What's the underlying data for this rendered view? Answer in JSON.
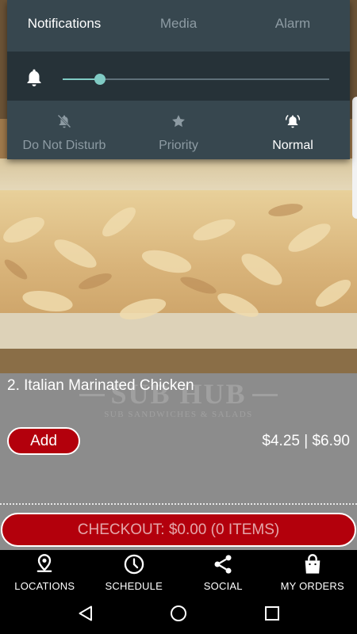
{
  "volume_panel": {
    "tabs": [
      {
        "label": "Notifications",
        "active": true
      },
      {
        "label": "Media",
        "active": false
      },
      {
        "label": "Alarm",
        "active": false
      }
    ],
    "volume_level_fraction": 0.14,
    "modes": [
      {
        "label": "Do Not Disturb",
        "icon": "bell-off-icon",
        "active": false
      },
      {
        "label": "Priority",
        "icon": "star-icon",
        "active": false
      },
      {
        "label": "Normal",
        "icon": "bell-ring-icon",
        "active": true
      }
    ],
    "colors": {
      "panel": "#37474f",
      "slider": "#80cbc4"
    }
  },
  "item": {
    "title": "2. Italian Marinated Chicken",
    "add_label": "Add",
    "price": "$4.25 | $6.90",
    "watermark_logo": "SUB HUB",
    "watermark_tagline": "SUB SANDWICHES & SALADS"
  },
  "checkout": {
    "label": "CHECKOUT: $0.00 (0 ITEMS)"
  },
  "tabbar": {
    "items": [
      {
        "label": "LOCATIONS",
        "icon": "location-pin-icon"
      },
      {
        "label": "SCHEDULE",
        "icon": "clock-icon"
      },
      {
        "label": "SOCIAL",
        "icon": "share-icon"
      },
      {
        "label": "MY ORDERS",
        "icon": "shopping-bag-icon"
      }
    ]
  },
  "colors": {
    "accent": "#b3000c",
    "card_bg": "#8c8c8c"
  }
}
